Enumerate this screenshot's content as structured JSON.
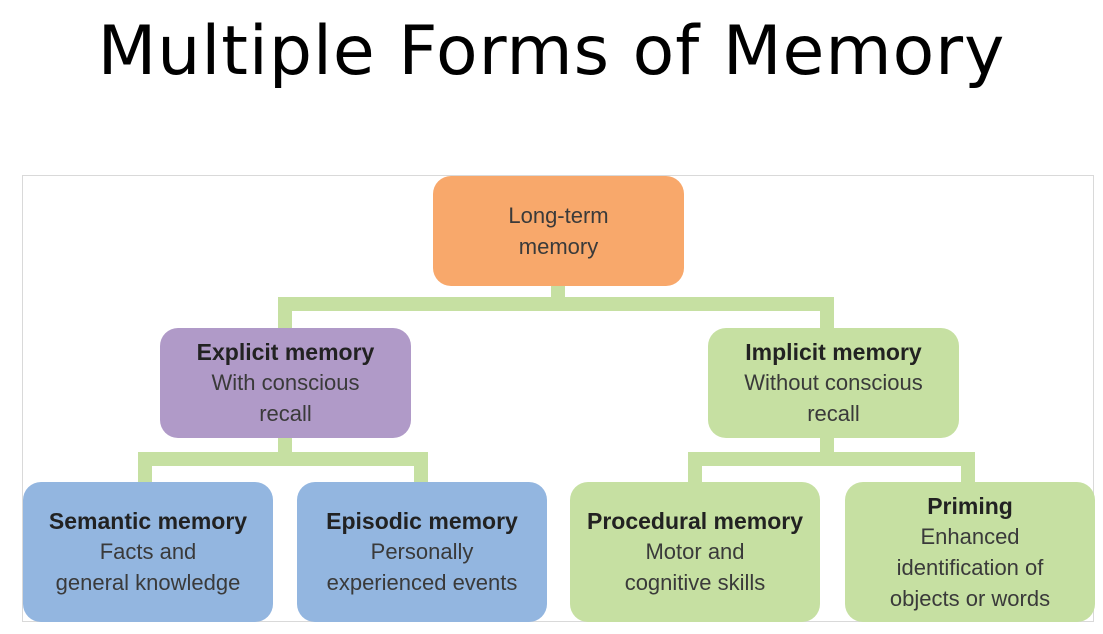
{
  "title": "Multiple Forms of Memory",
  "colors": {
    "root": "#f8a86b",
    "explicit": "#b09ac8",
    "implicit": "#c6e0a2",
    "explicit_children": "#93b6e0",
    "implicit_children": "#c6e0a2",
    "connector": "#c6e0a2"
  },
  "nodes": {
    "root": {
      "lines": [
        "Long-term",
        "memory"
      ]
    },
    "explicit": {
      "title": "Explicit memory",
      "lines": [
        "With conscious",
        "recall"
      ]
    },
    "implicit": {
      "title": "Implicit memory",
      "lines": [
        "Without conscious",
        "recall"
      ]
    },
    "semantic": {
      "title": "Semantic memory",
      "lines": [
        "Facts and",
        "general knowledge"
      ]
    },
    "episodic": {
      "title": "Episodic memory",
      "lines": [
        "Personally",
        "experienced events"
      ]
    },
    "procedural": {
      "title": "Procedural memory",
      "lines": [
        "Motor and",
        "cognitive skills"
      ]
    },
    "priming": {
      "title": "Priming",
      "lines": [
        "Enhanced",
        "identification of",
        "objects or words"
      ]
    }
  }
}
